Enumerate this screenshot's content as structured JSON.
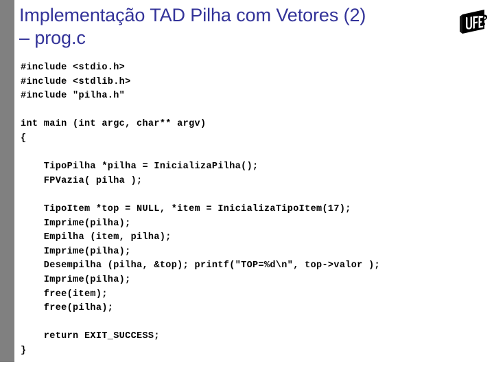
{
  "slide": {
    "title_lines": [
      "Implementação TAD Pilha com Vetores (2)",
      "– prog.c"
    ],
    "title_color": "#333399",
    "band_color": "#808080",
    "background_color": "#ffffff",
    "code_color": "#000000"
  },
  "logo": {
    "name": "ufes-logo",
    "text": "UFES",
    "alt": "UFES"
  },
  "code": {
    "language": "c",
    "lines": [
      "#include <stdio.h>",
      "#include <stdlib.h>",
      "#include \"pilha.h\"",
      "",
      "int main (int argc, char** argv)",
      "{",
      "",
      "    TipoPilha *pilha = InicializaPilha();",
      "    FPVazia( pilha );",
      "",
      "    TipoItem *top = NULL, *item = InicializaTipoItem(17);",
      "    Imprime(pilha);",
      "    Empilha (item, pilha);",
      "    Imprime(pilha);",
      "    Desempilha (pilha, &top); printf(\"TOP=%d\\n\", top->valor );",
      "    Imprime(pilha);",
      "    free(item);",
      "    free(pilha);",
      "",
      "    return EXIT_SUCCESS;",
      "}"
    ]
  }
}
